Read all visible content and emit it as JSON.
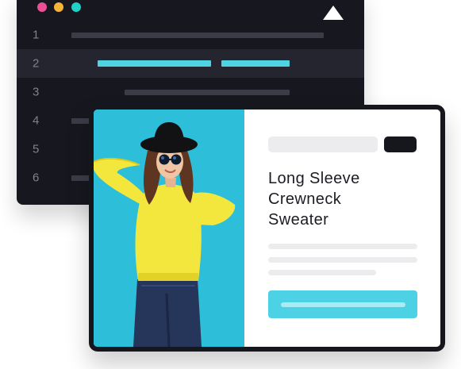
{
  "editor": {
    "window_dots": [
      "#ec4f95",
      "#f4b43a",
      "#1fd1c6"
    ],
    "line_numbers": [
      "1",
      "2",
      "3",
      "4",
      "5",
      "6"
    ],
    "active_line": "2"
  },
  "product_card": {
    "title_lines": [
      "Long Sleeve",
      "Crewneck",
      "Sweater"
    ],
    "image": "woman-yellow-sweater-photo"
  },
  "colors": {
    "editor_bg": "#17171f",
    "accent": "#4dd2e5",
    "photo_bg": "#2fc2dc"
  }
}
